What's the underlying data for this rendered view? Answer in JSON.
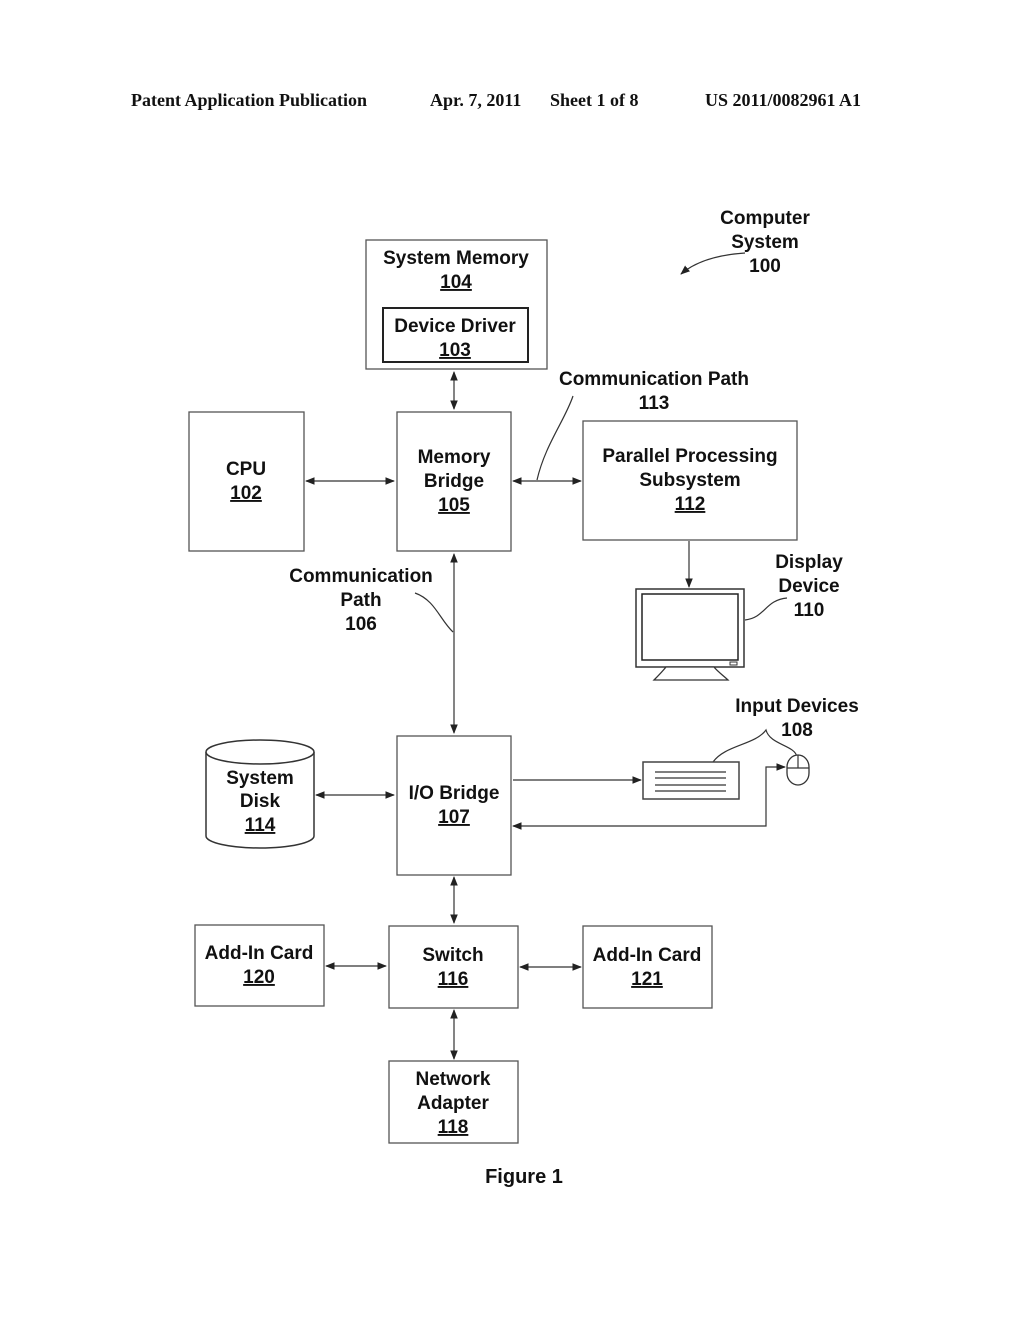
{
  "header": {
    "left": "Patent Application Publication",
    "date": "Apr. 7, 2011",
    "sheet": "Sheet 1 of 8",
    "number": "US 2011/0082961 A1"
  },
  "system": {
    "line1": "Computer",
    "line2": "System",
    "ref": "100"
  },
  "blocks": {
    "system_memory": {
      "line1": "System Memory",
      "ref": "104"
    },
    "device_driver": {
      "line1": "Device Driver",
      "ref": "103"
    },
    "cpu": {
      "line1": "CPU",
      "ref": "102"
    },
    "memory_bridge": {
      "line1": "Memory",
      "line2": "Bridge",
      "ref": "105"
    },
    "pps": {
      "line1": "Parallel Processing",
      "line2": "Subsystem",
      "ref": "112"
    },
    "io_bridge": {
      "line1": "I/O Bridge",
      "ref": "107"
    },
    "system_disk": {
      "line1": "System",
      "line2": "Disk",
      "ref": "114"
    },
    "switch": {
      "line1": "Switch",
      "ref": "116"
    },
    "addin_120": {
      "line1": "Add-In Card",
      "ref": "120"
    },
    "addin_121": {
      "line1": "Add-In Card",
      "ref": "121"
    },
    "network_adapter": {
      "line1": "Network",
      "line2": "Adapter",
      "ref": "118"
    }
  },
  "labels": {
    "comm_path_113": {
      "line1": "Communication Path",
      "ref": "113"
    },
    "comm_path_106": {
      "line1": "Communication",
      "line2": "Path",
      "ref": "106"
    },
    "display_device": {
      "line1": "Display",
      "line2": "Device",
      "ref": "110"
    },
    "input_devices": {
      "line1": "Input Devices",
      "ref": "108"
    }
  },
  "icons": [
    "monitor-icon",
    "keyboard-icon",
    "mouse-icon",
    "disk-cylinder-icon"
  ],
  "caption": "Figure 1"
}
